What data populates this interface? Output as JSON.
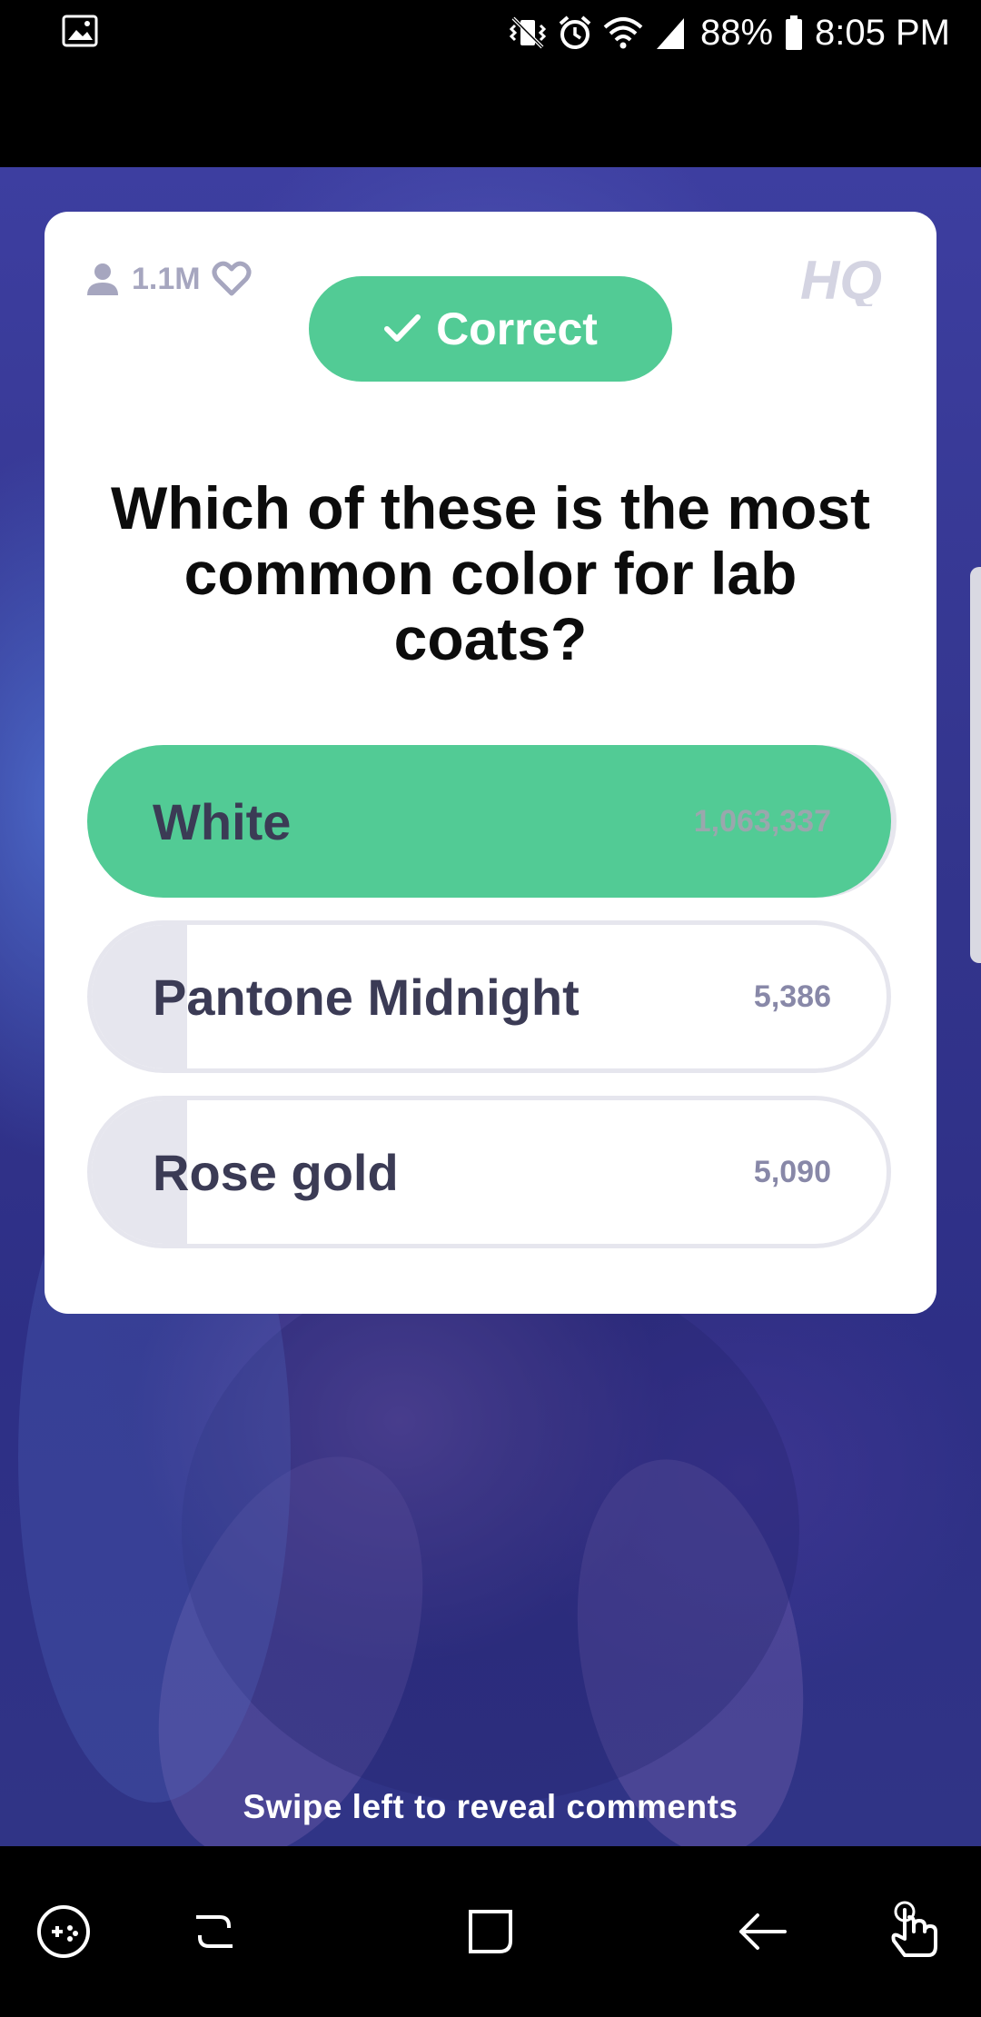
{
  "status_bar": {
    "battery_percent": "88%",
    "time": "8:05 PM",
    "icons": [
      "gallery-icon",
      "mute-vibrate-icon",
      "alarm-icon",
      "wifi-icon",
      "signal-icon",
      "battery-icon"
    ]
  },
  "card": {
    "viewer_count": "1.1M",
    "logo": "HQ",
    "result_label": "Correct",
    "question": "Which of these is the most common color for lab coats?",
    "answers": [
      {
        "label": "White",
        "count": "1,063,337",
        "correct": true,
        "share": 0.99
      },
      {
        "label": "Pantone Midnight",
        "count": "5,386",
        "correct": false,
        "share": 0.12
      },
      {
        "label": "Rose gold",
        "count": "5,090",
        "correct": false,
        "share": 0.12
      }
    ],
    "colors": {
      "correct": "#52cb95",
      "neutral": "#e6e6ee",
      "muted_text": "#a6a6bf"
    }
  },
  "swipe_hint": "Swipe left to reveal comments",
  "nav_bar": {
    "icons": [
      "game-tools-icon",
      "recents-icon",
      "home-icon",
      "back-icon",
      "gesture-icon"
    ]
  }
}
